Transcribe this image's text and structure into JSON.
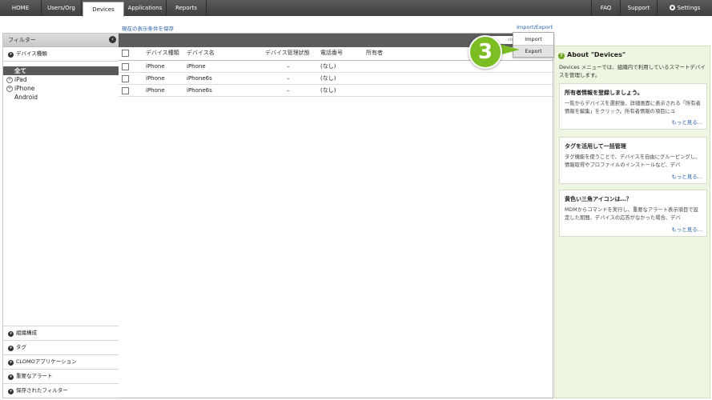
{
  "nav": {
    "tabs": [
      {
        "label": "HOME"
      },
      {
        "label": "Users/Org"
      },
      {
        "label": "Devices"
      },
      {
        "label": "Applications"
      },
      {
        "label": "Reports"
      }
    ],
    "right": {
      "faq": "FAQ",
      "support": "Support",
      "settings": "Settings"
    }
  },
  "links": {
    "save_view": "現在の表示条件を保存",
    "import_export": "Import/Export"
  },
  "sidebar": {
    "title": "フィルター",
    "section": "デバイス種類",
    "tree": [
      {
        "label": "全て"
      },
      {
        "label": "iPad",
        "expander": "+"
      },
      {
        "label": "iPhone",
        "expander": "+"
      },
      {
        "label": "Android"
      }
    ],
    "bottom": [
      {
        "label": "組織構成"
      },
      {
        "label": "タグ"
      },
      {
        "label": "CLOMOアプリケーション"
      },
      {
        "label": "重要なアラート"
      },
      {
        "label": "保存されたフィルター"
      }
    ]
  },
  "table": {
    "search_hint": "ch",
    "columns": [
      "デバイス種類",
      "デバイス名",
      "デバイス管理状態",
      "電話番号",
      "所有者"
    ],
    "rows": [
      {
        "type": "iPhone",
        "name": "iPhone",
        "status": "–",
        "phone": "(なし)",
        "owner": ""
      },
      {
        "type": "iPhone",
        "name": "iPhone6s",
        "status": "–",
        "phone": "(なし)",
        "owner": ""
      },
      {
        "type": "iPhone",
        "name": "iPhone6s",
        "status": "–",
        "phone": "(なし)",
        "owner": ""
      }
    ]
  },
  "dropdown": {
    "import": "Import",
    "export": "Export"
  },
  "callout": {
    "number": "3"
  },
  "about": {
    "title": "About \"Devices\"",
    "description": "Devices メニューでは、組織内で利用しているスマートデバイスを管理します。",
    "cards": [
      {
        "title": "所有者情報を登録しましょう。",
        "body": "一覧からデバイスを選択後、詳細画面に表示される「所有者情報を編集」をクリック。所有者情報の項目にユ",
        "more": "もっと見る..."
      },
      {
        "title": "タグを活用して一括管理",
        "body": "タグ機能を使うことで、デバイスを自由にグルーピングし、情報取得やプロファイルのインストールなど、デバ",
        "more": "もっと見る..."
      },
      {
        "title": "黄色い三角アイコンは…？",
        "body": "MDMからコマンドを実行し、重要なアラート表示項目で設定した期間、デバイスの応答がなかった場合、デバ",
        "more": "もっと見る..."
      }
    ]
  }
}
